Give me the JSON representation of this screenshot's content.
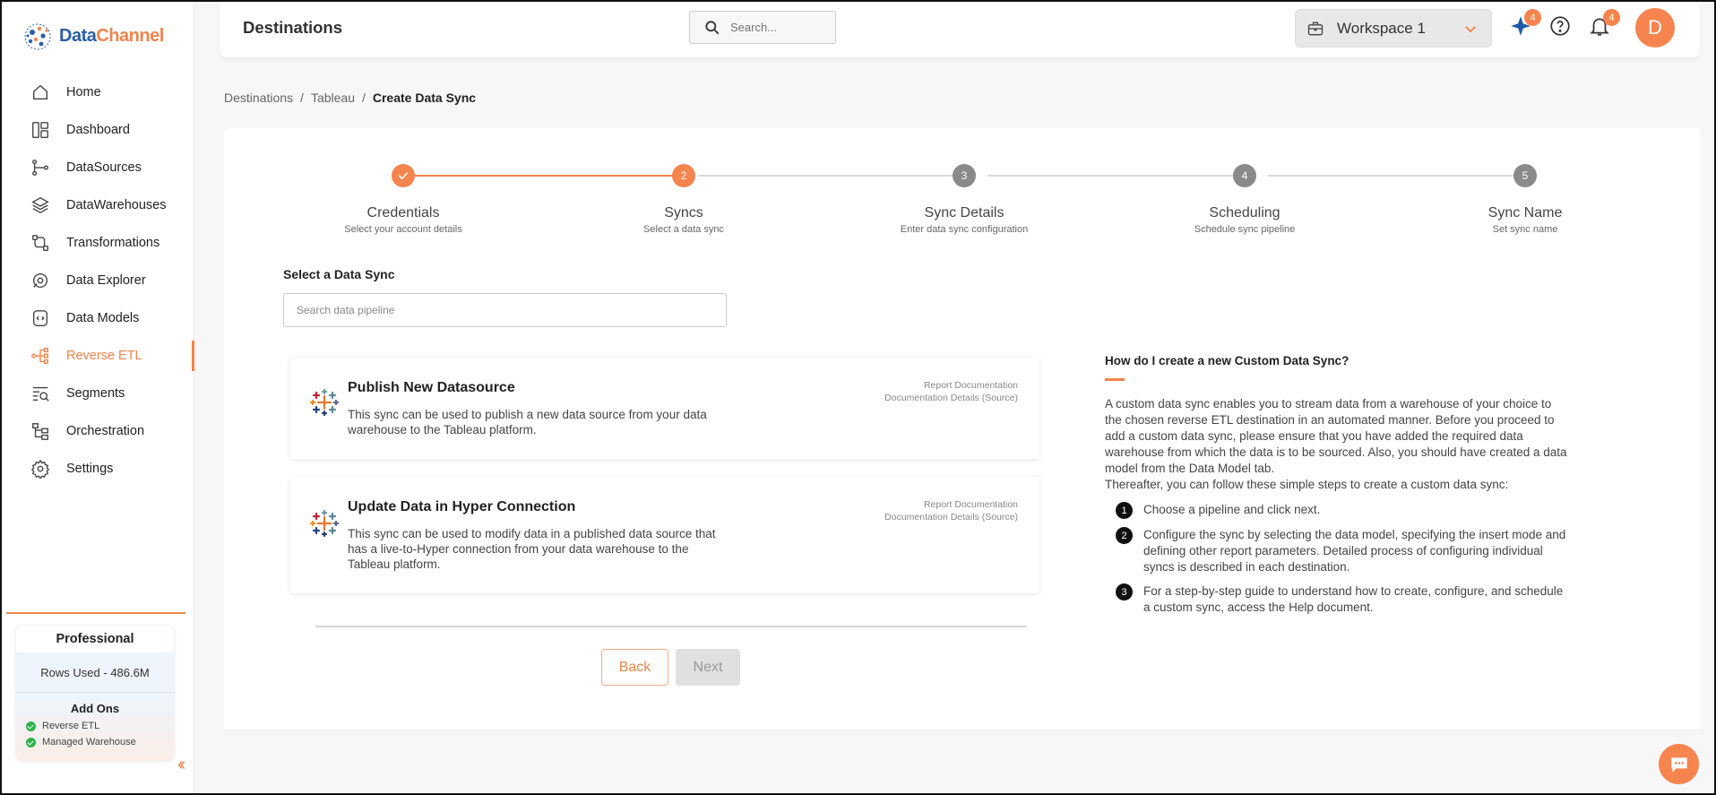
{
  "brand": {
    "name_part1": "Data",
    "name_part2": "Channel"
  },
  "sidebar": {
    "items": [
      {
        "label": "Home",
        "icon": "home-icon"
      },
      {
        "label": "Dashboard",
        "icon": "dashboard-icon"
      },
      {
        "label": "DataSources",
        "icon": "datasources-icon"
      },
      {
        "label": "DataWarehouses",
        "icon": "datawarehouses-icon"
      },
      {
        "label": "Transformations",
        "icon": "transformations-icon"
      },
      {
        "label": "Data Explorer",
        "icon": "data-explorer-icon"
      },
      {
        "label": "Data Models",
        "icon": "data-models-icon"
      },
      {
        "label": "Reverse ETL",
        "icon": "reverse-etl-icon",
        "active": true
      },
      {
        "label": "Segments",
        "icon": "segments-icon"
      },
      {
        "label": "Orchestration",
        "icon": "orchestration-icon"
      },
      {
        "label": "Settings",
        "icon": "settings-icon"
      }
    ],
    "plan": {
      "name": "Professional",
      "rows_used": "Rows Used - 486.6M",
      "addons_title": "Add Ons",
      "addons": [
        "Reverse ETL",
        "Managed Warehouse"
      ]
    }
  },
  "header": {
    "title": "Destinations",
    "search_placeholder": "Search...",
    "workspace": "Workspace 1",
    "ai_badge": "4",
    "notifications_badge": "4",
    "avatar_letter": "D"
  },
  "breadcrumb": {
    "items": [
      "Destinations",
      "Tableau"
    ],
    "current": "Create Data Sync"
  },
  "stepper": {
    "current_step": 2,
    "steps": [
      {
        "number": "1",
        "title": "Credentials",
        "subtitle": "Select your account details",
        "state": "done"
      },
      {
        "number": "2",
        "title": "Syncs",
        "subtitle": "Select a data sync",
        "state": "active"
      },
      {
        "number": "3",
        "title": "Sync Details",
        "subtitle": "Enter data sync configuration",
        "state": "pending"
      },
      {
        "number": "4",
        "title": "Scheduling",
        "subtitle": "Schedule sync pipeline",
        "state": "pending"
      },
      {
        "number": "5",
        "title": "Sync Name",
        "subtitle": "Set sync name",
        "state": "pending"
      }
    ]
  },
  "form": {
    "section_label": "Select a Data Sync",
    "search_placeholder": "Search data pipeline",
    "syncs": [
      {
        "title": "Publish New Datasource",
        "description": "This sync can be used to publish a new data source from your data warehouse to the Tableau platform.",
        "link1": "Report Documentation",
        "link2": "Documentation Details (Source)"
      },
      {
        "title": "Update Data in Hyper Connection",
        "description": "This sync can be used to modify data in a published data source that has a live-to-Hyper connection from your data warehouse to the Tableau platform.",
        "link1": "Report Documentation",
        "link2": "Documentation Details (Source)"
      }
    ],
    "back_label": "Back",
    "next_label": "Next"
  },
  "help": {
    "title": "How do I create a new Custom Data Sync?",
    "intro": "A custom data sync enables you to stream data from a warehouse of your choice to the chosen reverse ETL destination in an automated manner. Before you proceed to add a custom data sync, please ensure that you have added the required data warehouse from which the data is to be sourced. Also, you should have created a data model from the Data Model tab.",
    "intro2": "Thereafter, you can follow these simple steps to create a custom data sync:",
    "steps": [
      {
        "n": "1",
        "text": "Choose a pipeline and click next."
      },
      {
        "n": "2",
        "text": "Configure the sync by selecting the data model, specifying the insert mode and defining other report parameters. Detailed process of configuring individual syncs is described in each destination."
      },
      {
        "n": "3",
        "text": "For a step-by-step guide to understand how to create, configure, and schedule a custom sync, access the Help document."
      }
    ]
  },
  "colors": {
    "accent": "#f0844a",
    "success": "#2bb24c",
    "pending_step": "#8a8a8a"
  }
}
